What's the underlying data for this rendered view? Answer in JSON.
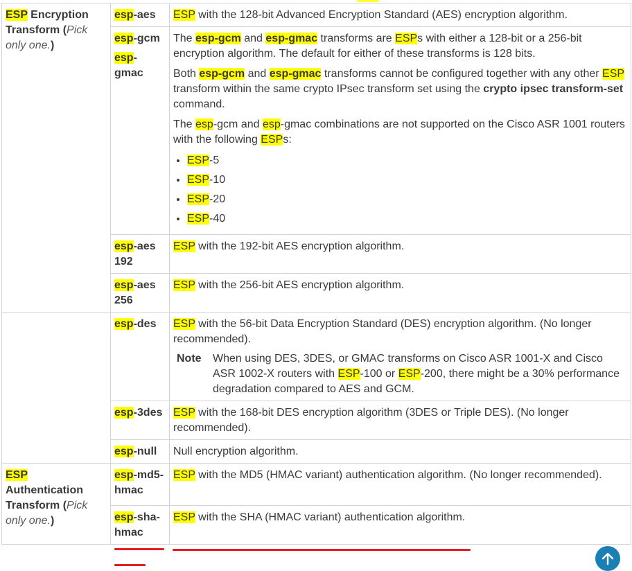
{
  "group_encryption": {
    "keyword": "ESP",
    "title_rest": " Encryption Transform",
    "pick": "Pick only one."
  },
  "group_authentication": {
    "keyword": "ESP",
    "title_rest": " Authentication Transform",
    "pick": "Pick only one."
  },
  "esp_word": "ESP",
  "esp_lower": "esp",
  "rows": {
    "aes": {
      "kw_rest": "-aes",
      "desc_rest": " with the 128-bit Advanced Encryption Standard (AES) encryption algorithm."
    },
    "gcm": {
      "kw1_rest": "-gcm",
      "kw2_rest": "-gmac",
      "p1_a": "The ",
      "p1_gcm": "esp-gcm",
      "p1_and": " and ",
      "p1_gmac": "esp-gmac",
      "p1_b": " transforms are ",
      "p1_c": "s with either a 128-bit or a 256-bit encryption algorithm. The default for either of these transforms is 128 bits.",
      "p2_a": "Both ",
      "p2_gcm": "esp-gcm",
      "p2_and": " and ",
      "p2_gmac": "esp-gmac",
      "p2_b": " transforms cannot be configured together with any other ",
      "p2_c": " transform within the same crypto IPsec transform set using the ",
      "p2_cmd": "crypto ipsec transform-set",
      "p2_d": " command.",
      "p3_a": "The ",
      "p3_b": "-gcm and ",
      "p3_c": "-gmac combinations are not supported on the Cisco ASR 1001 routers with the following ",
      "p3_d": "s:",
      "list": [
        "-5",
        "-10",
        "-20",
        "-40"
      ]
    },
    "aes192": {
      "kw_rest": "-aes 192",
      "desc_rest": " with the 192-bit AES encryption algorithm."
    },
    "aes256": {
      "kw_rest": "-aes 256",
      "desc_rest": " with the 256-bit AES encryption algorithm."
    },
    "des": {
      "kw_rest": "-des",
      "desc_rest": " with the 56-bit Data Encryption Standard (DES) encryption algorithm. (No longer recommended).",
      "note_label": "Note",
      "note_a": "When using DES, 3DES, or GMAC transforms on Cisco ASR 1001-X and Cisco ASR 1002-X routers with ",
      "note_b": "-100 or ",
      "note_c": "-200, there might be a 30% performance degradation compared to AES and GCM."
    },
    "3des": {
      "kw_rest": "-3des",
      "desc_rest": " with the 168-bit DES encryption algorithm (3DES or Triple DES). (No longer recommended)."
    },
    "null": {
      "kw_rest": "-null",
      "desc": "Null encryption algorithm."
    },
    "md5": {
      "kw_rest": "-md5-hmac",
      "desc_rest": " with the MD5 (HMAC variant) authentication algorithm. (No longer recommended)."
    },
    "sha": {
      "kw_rest": "-sha-hmac",
      "desc_rest": " with the SHA (HMAC variant) authentication algorithm."
    }
  },
  "icons": {
    "scroll_top": "arrow-up-icon"
  },
  "colors": {
    "highlight": "#ffff00",
    "annotation": "#e31b23",
    "scroll_button": "#1a7fb5"
  }
}
